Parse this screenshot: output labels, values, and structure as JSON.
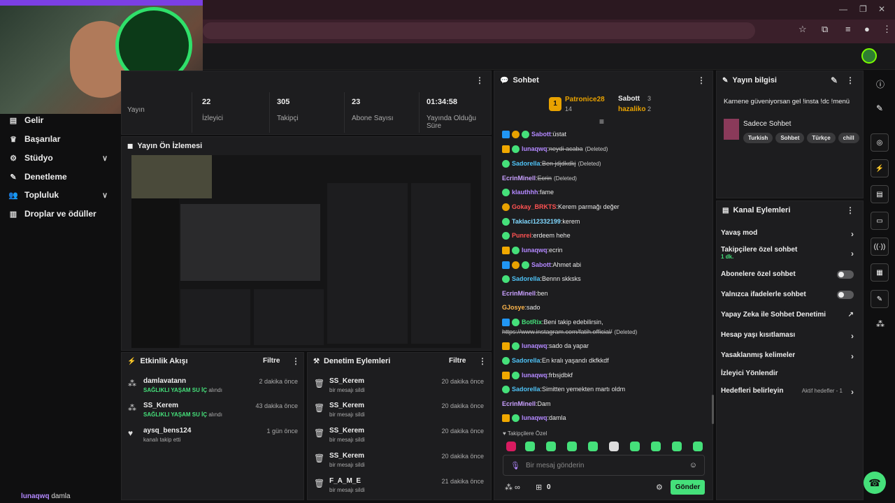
{
  "browser": {
    "window_controls": [
      "—",
      "❐",
      "✕"
    ],
    "toolbar_icons": [
      "star-icon",
      "extension-icon",
      "media-icon",
      "profile-icon",
      "menu-icon"
    ]
  },
  "stats": [
    {
      "value": "",
      "label": "Yayın"
    },
    {
      "value": "22",
      "label": "İzleyici"
    },
    {
      "value": "305",
      "label": "Takipçi"
    },
    {
      "value": "23",
      "label": "Abone Sayısı"
    },
    {
      "value": "01:34:58",
      "label": "Yayında Olduğu Süre"
    }
  ],
  "sidebar": {
    "items": [
      {
        "label": "Gelir",
        "icon": "wallet-icon",
        "chevron": false
      },
      {
        "label": "Başarılar",
        "icon": "trophy-icon",
        "chevron": false
      },
      {
        "label": "Stüdyo",
        "icon": "sliders-icon",
        "chevron": true
      },
      {
        "label": "Denetleme",
        "icon": "wrench-icon",
        "chevron": false
      },
      {
        "label": "Topluluk",
        "icon": "users-icon",
        "chevron": true
      },
      {
        "label": "Droplar ve ödüller",
        "icon": "chart-icon",
        "chevron": false
      }
    ],
    "footer_user": "lunaqwq",
    "footer_text": "damla"
  },
  "preview": {
    "title": "Yayın Ön İzlemesi"
  },
  "activity": {
    "title": "Etkinlik Akışı",
    "filter": "Filtre",
    "rows": [
      {
        "icon": "share-icon",
        "name": "damlavatann",
        "time": "2 dakika önce",
        "highlight": "SAĞLIKLI YAŞAM SU İÇ",
        "suffix": "alındı"
      },
      {
        "icon": "share-icon",
        "name": "SS_Kerem",
        "time": "43 dakika önce",
        "highlight": "SAĞLIKLI YAŞAM SU İÇ",
        "suffix": "alındı"
      },
      {
        "icon": "heart-icon",
        "name": "aysq_bens124",
        "time": "1 gün önce",
        "highlight": "",
        "suffix": "kanalı takip etti"
      }
    ]
  },
  "moderation": {
    "title": "Denetim Eylemleri",
    "filter": "Filtre",
    "rows": [
      {
        "name": "SS_Kerem",
        "time": "20 dakika önce",
        "sub": "bir mesajı sildi"
      },
      {
        "name": "SS_Kerem",
        "time": "20 dakika önce",
        "sub": "bir mesajı sildi"
      },
      {
        "name": "SS_Kerem",
        "time": "20 dakika önce",
        "sub": "bir mesajı sildi"
      },
      {
        "name": "SS_Kerem",
        "time": "20 dakika önce",
        "sub": "bir mesajı sildi"
      },
      {
        "name": "F_A_M_E",
        "time": "21 dakika önce",
        "sub": "bir mesajı sildi"
      }
    ]
  },
  "chat": {
    "title": "Sohbet",
    "leaderboard": [
      {
        "name": "Patronice28",
        "count": "14"
      },
      {
        "name": "Sabott",
        "count": "3"
      },
      {
        "name": "hazaliko",
        "count": "2"
      }
    ],
    "messages": [
      {
        "badges": [
          "mod",
          "gold",
          "sub"
        ],
        "user": "Sabott",
        "color": "#b388ff",
        "text": "üstat",
        "deleted": false
      },
      {
        "badges": [
          "crown",
          "sub"
        ],
        "user": "lunaqwq",
        "color": "#b388ff",
        "text": "neydi acaba",
        "deleted": true
      },
      {
        "badges": [
          "sub"
        ],
        "user": "Sadorella",
        "color": "#4fc3f7",
        "text": "Ben jdjdkdkj",
        "deleted": true
      },
      {
        "badges": [],
        "user": "EcrinMinell",
        "color": "#c9a0ff",
        "text": "Ecrin",
        "deleted": true
      },
      {
        "badges": [
          "sub"
        ],
        "user": "klauthhh",
        "color": "#b388ff",
        "text": "fame",
        "deleted": false
      },
      {
        "badges": [
          "gold"
        ],
        "user": "Gokay_BRKTS",
        "color": "#ff5252",
        "text": "Kerem parmağı değer",
        "deleted": false
      },
      {
        "badges": [
          "sub"
        ],
        "user": "Taklaci12332199",
        "color": "#80d8ff",
        "text": "kerem",
        "deleted": false
      },
      {
        "badges": [
          "sub"
        ],
        "user": "Punrei",
        "color": "#ff5252",
        "text": "erdeem hehe",
        "deleted": false
      },
      {
        "badges": [
          "crown",
          "sub"
        ],
        "user": "lunaqwq",
        "color": "#b388ff",
        "text": "ecrin",
        "deleted": false
      },
      {
        "badges": [
          "mod",
          "gold",
          "sub"
        ],
        "user": "Sabott",
        "color": "#b388ff",
        "text": "Ahmet abi",
        "deleted": false
      },
      {
        "badges": [
          "sub"
        ],
        "user": "Sadorella",
        "color": "#4fc3f7",
        "text": "Bennn skksks",
        "deleted": false
      },
      {
        "badges": [],
        "user": "EcrinMinell",
        "color": "#c9a0ff",
        "text": "ben",
        "deleted": false
      },
      {
        "badges": [],
        "user": "GJosye",
        "color": "#ffb74d",
        "text": "sado",
        "deleted": false
      },
      {
        "badges": [
          "mod",
          "sub"
        ],
        "user": "BotRix",
        "color": "#45e07a",
        "text": "Beni takip edebilirsin,",
        "deleted": false
      },
      {
        "badges": [],
        "user": "",
        "color": "#e8e8e8",
        "text": "https://www.instagram.com/fatih.official/",
        "deleted": true
      },
      {
        "badges": [
          "crown",
          "sub"
        ],
        "user": "lunaqwq",
        "color": "#b388ff",
        "text": "sado da yapar",
        "deleted": false
      },
      {
        "badges": [
          "sub"
        ],
        "user": "Sadorella",
        "color": "#4fc3f7",
        "text": "En kralı yaşandı dkfkkdf",
        "deleted": false
      },
      {
        "badges": [
          "crown",
          "sub"
        ],
        "user": "lunaqwq",
        "color": "#b388ff",
        "text": "frbsjdbkf",
        "deleted": false
      },
      {
        "badges": [
          "sub"
        ],
        "user": "Sadorella",
        "color": "#4fc3f7",
        "text": "Simitten yemekten martı oldm",
        "deleted": false
      },
      {
        "badges": [],
        "user": "EcrinMinell",
        "color": "#c9a0ff",
        "text": "Dam",
        "deleted": false
      },
      {
        "badges": [
          "crown",
          "sub"
        ],
        "user": "lunaqwq",
        "color": "#b388ff",
        "text": "damla",
        "deleted": false
      }
    ],
    "deleted_label": "(Deleted)",
    "followers_only": "Takipçilere Özel",
    "input_placeholder": "Bir mesaj gönderin",
    "footer_count": "0",
    "send": "Gönder"
  },
  "stream_info": {
    "title": "Yayın bilgisi",
    "stream_title": "Karnene güveniyorsan gel !insta !dc !menü",
    "category": "Sadece Sohbet",
    "tags": [
      "Turkish",
      "Sohbet",
      "Türkçe",
      "chill"
    ]
  },
  "channel_actions": {
    "title": "Kanal Eylemleri",
    "rows": [
      {
        "label": "Yavaş mod",
        "control": "chevron",
        "sub": ""
      },
      {
        "label": "Takipçilere özel sohbet",
        "control": "chevron",
        "sub": "1 dk."
      },
      {
        "label": "Abonelere özel sohbet",
        "control": "toggle",
        "sub": ""
      },
      {
        "label": "Yalnızca ifadelerle sohbet",
        "control": "toggle",
        "sub": ""
      },
      {
        "label": "Yapay Zeka ile Sohbet Denetimi",
        "control": "external",
        "sub": ""
      },
      {
        "label": "Hesap yaşı kısıtlaması",
        "control": "chevron",
        "sub": ""
      },
      {
        "label": "Yasaklanmış kelimeler",
        "control": "chevron",
        "sub": ""
      },
      {
        "label": "İzleyici Yönlendir",
        "control": "none",
        "sub": ""
      },
      {
        "label": "Hedefleri belirleyin",
        "control": "chevron",
        "sub": "Aktif hedefler - 1"
      }
    ]
  },
  "rail_icons": [
    "info-icon",
    "pencil-icon",
    "camera-icon",
    "bolt-icon",
    "document-icon",
    "chat-icon",
    "broadcast-icon",
    "layout-icon",
    "wrench-icon",
    "share-icon"
  ],
  "colors": {
    "accent": "#45e07a",
    "panel": "#1d1d1f",
    "background": "#0f0f10"
  }
}
